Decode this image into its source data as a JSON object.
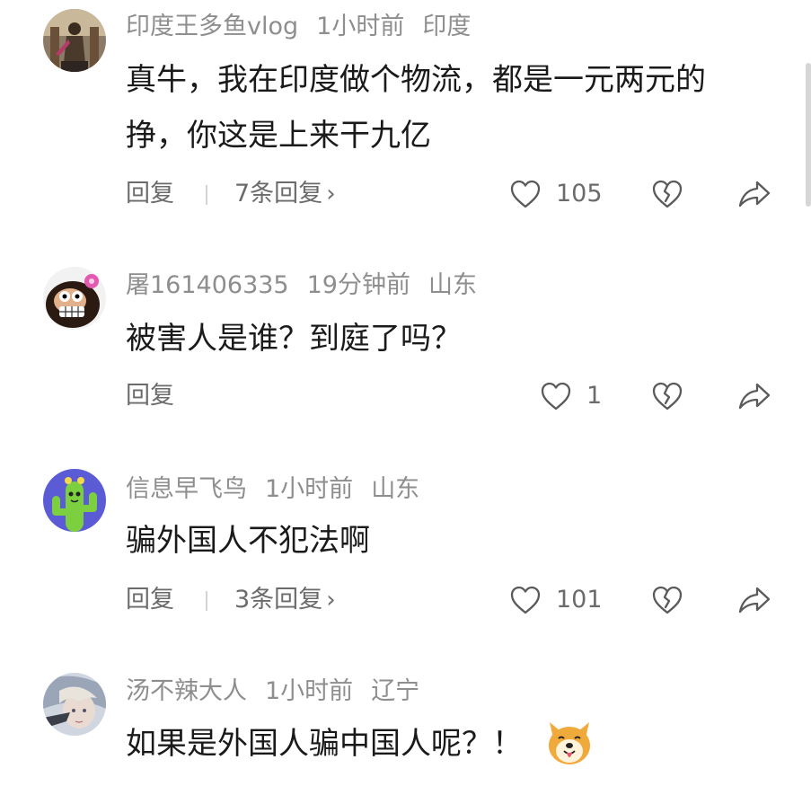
{
  "comments": [
    {
      "user": "印度王多鱼vlog",
      "time": "1小时前",
      "location": "印度",
      "text_lines": [
        "真牛，我在印度做个物流，都是一元两元的",
        "挣，你这是上来干九亿"
      ],
      "reply_label": "回复",
      "replies_label": "7条回复",
      "likes": "105",
      "avatar_icon": "statue-avatar"
    },
    {
      "user": "屠161406335",
      "time": "19分钟前",
      "location": "山东",
      "text_lines": [
        "被害人是谁？到庭了吗？"
      ],
      "reply_label": "回复",
      "likes": "1",
      "avatar_icon": "cartoon-face-avatar"
    },
    {
      "user": "信息早飞鸟",
      "time": "1小时前",
      "location": "山东",
      "text_lines": [
        "骗外国人不犯法啊"
      ],
      "reply_label": "回复",
      "replies_label": "3条回复",
      "likes": "101",
      "avatar_icon": "cactus-avatar"
    },
    {
      "user": "汤不辣大人",
      "time": "1小时前",
      "location": "辽宁",
      "text_lines": [
        "如果是外国人骗中国人呢？！"
      ],
      "emoji": "shiba-dog-emoji",
      "avatar_icon": "anime-character-avatar"
    }
  ],
  "colors": {
    "meta_text": "#8e8e8e",
    "body_text": "#1a1a1a",
    "action_text": "#6b6b6b",
    "cactus_bg": "#5b5bd6",
    "cactus_green": "#7ccf3f"
  },
  "icons": [
    "heart-outline-icon",
    "broken-heart-icon",
    "share-arrow-icon",
    "chevron-right-icon"
  ]
}
